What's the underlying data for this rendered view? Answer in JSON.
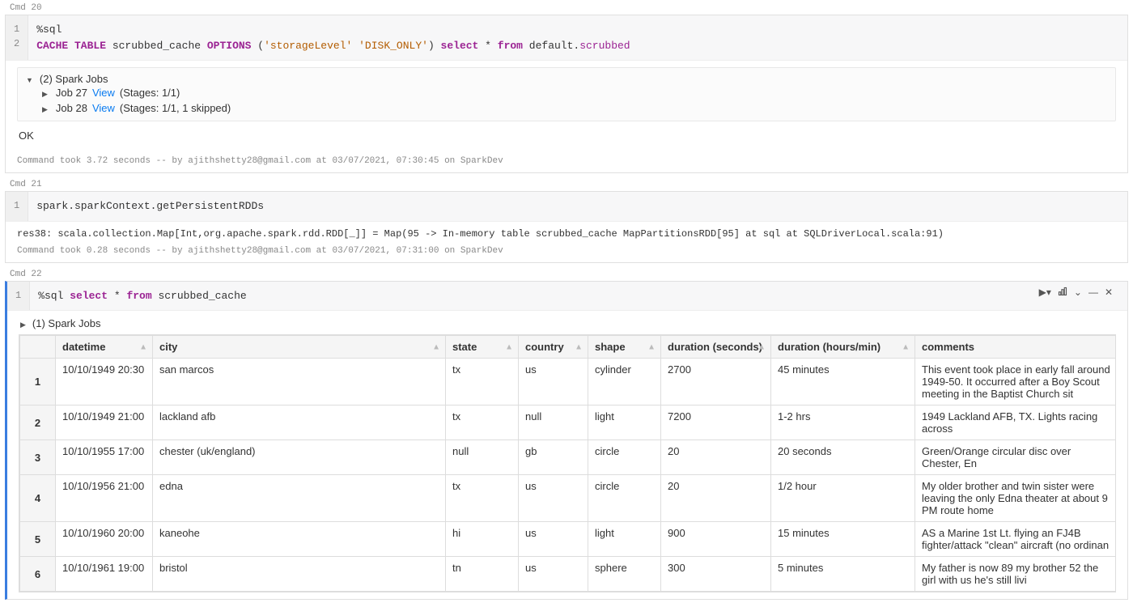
{
  "cmd20": {
    "label": "Cmd 20",
    "code": {
      "line1": "%sql",
      "line2_parts": {
        "kw1": "CACHE TABLE",
        "tbl": " scrubbed_cache ",
        "kw2": "OPTIONS",
        "paren_open": " (",
        "str1": "'storageLevel'",
        "sp": " ",
        "str2": "'DISK_ONLY'",
        "paren_close": ") ",
        "kw3": "select",
        "star": " * ",
        "kw4": "from",
        "rest": " default.",
        "d": "scrubbed"
      }
    },
    "jobs_header": "(2) Spark Jobs",
    "job_a": {
      "label": "Job 27",
      "view": "View",
      "stages": "(Stages: 1/1)"
    },
    "job_b": {
      "label": "Job 28",
      "view": "View",
      "stages": "(Stages: 1/1, 1 skipped)"
    },
    "ok": "OK",
    "footer": "Command took 3.72 seconds -- by ajithshetty28@gmail.com at 03/07/2021, 07:30:45 on SparkDev"
  },
  "cmd21": {
    "label": "Cmd 21",
    "code": "spark.sparkContext.getPersistentRDDs",
    "output": "res38: scala.collection.Map[Int,org.apache.spark.rdd.RDD[_]] = Map(95 -> In-memory table scrubbed_cache MapPartitionsRDD[95] at sql at SQLDriverLocal.scala:91)",
    "footer": "Command took 0.28 seconds -- by ajithshetty28@gmail.com at 03/07/2021, 07:31:00 on SparkDev"
  },
  "cmd22": {
    "label": "Cmd 22",
    "code": {
      "magic": "%sql ",
      "kw1": "select",
      "star": " * ",
      "kw2": "from",
      "tbl": " scrubbed_cache"
    },
    "jobs_header": "(1) Spark Jobs",
    "table": {
      "headers": [
        "datetime",
        "city",
        "state",
        "country",
        "shape",
        "duration (seconds)",
        "duration (hours/min)",
        "comments"
      ],
      "rows": [
        {
          "n": "1",
          "datetime": "10/10/1949 20:30",
          "city": "san marcos",
          "state": "tx",
          "country": "us",
          "shape": "cylinder",
          "dsec": "2700",
          "dhm": "45 minutes",
          "comments": "This event took place in early fall around 1949-50. It occurred after a Boy Scout meeting in the Baptist Church sit"
        },
        {
          "n": "2",
          "datetime": "10/10/1949 21:00",
          "city": "lackland afb",
          "state": "tx",
          "country": "null",
          "shape": "light",
          "dsec": "7200",
          "dhm": "1-2 hrs",
          "comments": "1949 Lackland AFB&#44 TX. Lights racing across"
        },
        {
          "n": "3",
          "datetime": "10/10/1955 17:00",
          "city": "chester (uk/england)",
          "state": "null",
          "country": "gb",
          "shape": "circle",
          "dsec": "20",
          "dhm": "20 seconds",
          "comments": "Green/Orange circular disc over Chester&#44 En"
        },
        {
          "n": "4",
          "datetime": "10/10/1956 21:00",
          "city": "edna",
          "state": "tx",
          "country": "us",
          "shape": "circle",
          "dsec": "20",
          "dhm": "1/2 hour",
          "comments": "My older brother and twin sister were leaving the only Edna theater at about 9 PM route home"
        },
        {
          "n": "5",
          "datetime": "10/10/1960 20:00",
          "city": "kaneohe",
          "state": "hi",
          "country": "us",
          "shape": "light",
          "dsec": "900",
          "dhm": "15 minutes",
          "comments": "AS a Marine 1st Lt. flying an FJ4B fighter/attack &quot;clean&quot; aircraft (no ordinan"
        },
        {
          "n": "6",
          "datetime": "10/10/1961 19:00",
          "city": "bristol",
          "state": "tn",
          "country": "us",
          "shape": "sphere",
          "dsec": "300",
          "dhm": "5 minutes",
          "comments": "My father is now 89 my brother 52 the girl with us he&#39s still livi"
        }
      ]
    }
  }
}
